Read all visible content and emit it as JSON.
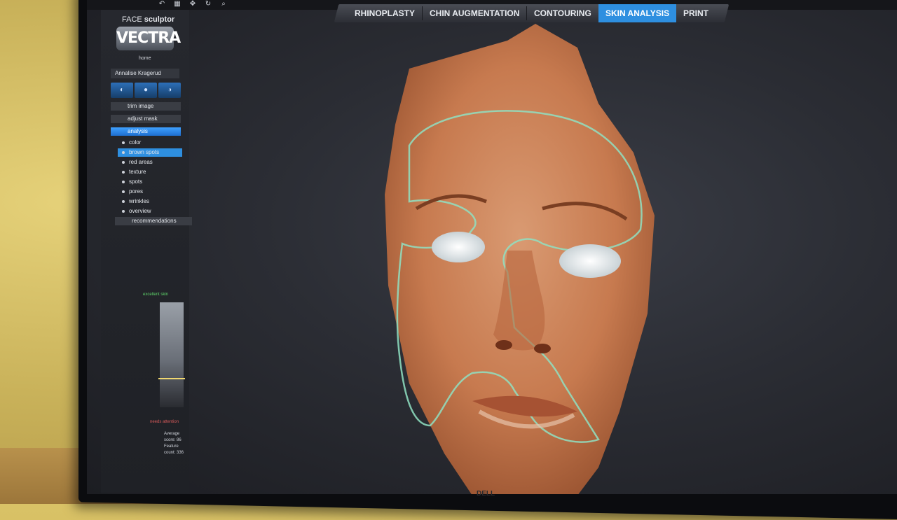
{
  "app": {
    "brand_small_prefix": "FACE",
    "brand_small_suffix": "sculptor",
    "logo": "VECTRA",
    "home_label": "home",
    "patient_name": "Annalise Kragerud"
  },
  "toolbar": {
    "icons": [
      "undo-icon",
      "grid-icon",
      "move-icon",
      "rotate-icon",
      "search-icon"
    ]
  },
  "tabs": [
    {
      "label": "RHINOPLASTY",
      "active": false
    },
    {
      "label": "CHIN AUGMENTATION",
      "active": false
    },
    {
      "label": "CONTOURING",
      "active": false
    },
    {
      "label": "SKIN ANALYSIS",
      "active": true
    },
    {
      "label": "PRINT",
      "active": false
    }
  ],
  "sidebar": {
    "menu": {
      "trim_image": "trim image",
      "adjust_mask": "adjust mask",
      "analysis": "analysis"
    },
    "analysis_items": [
      "color",
      "brown spots",
      "red areas",
      "texture",
      "spots",
      "pores",
      "wrinkles",
      "overview"
    ],
    "selected_item": "brown spots",
    "recommendations": "recommendations",
    "scale": {
      "top_label": "excellent skin",
      "bottom_label": "needs attention",
      "level_fraction": 0.72
    },
    "stats": {
      "average_score": "Average score: 86",
      "feature_count": "Feature count: 336"
    }
  },
  "colors": {
    "accent": "#2e8fe0",
    "mask_outline": "#8fe0c2",
    "skin": "#c77a4f"
  },
  "monitor": {
    "brand": "DELL"
  }
}
